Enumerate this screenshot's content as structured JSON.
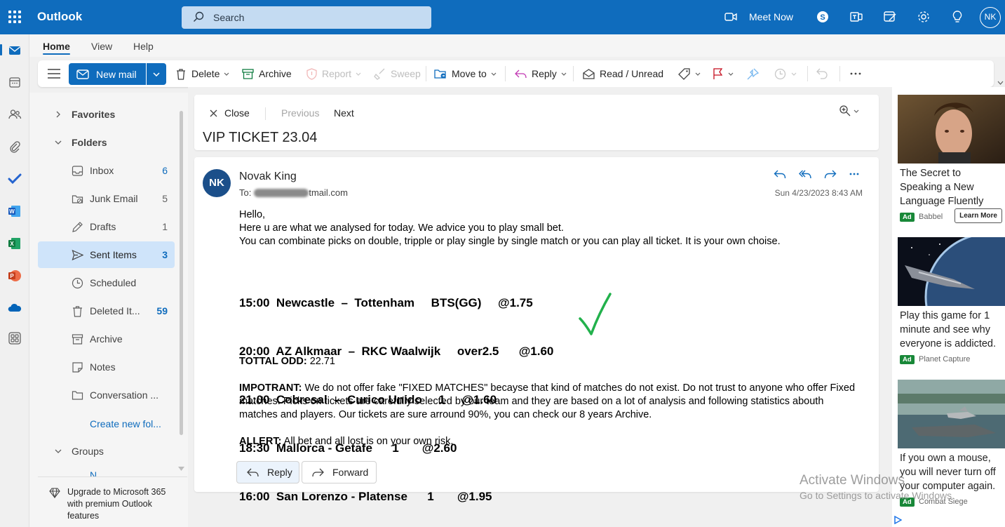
{
  "topbar": {
    "app_name": "Outlook",
    "search_placeholder": "Search",
    "meet_now": "Meet Now",
    "avatar_initials": "NK"
  },
  "tabs": [
    "Home",
    "View",
    "Help"
  ],
  "toolbar": {
    "new_mail": "New mail",
    "delete": "Delete",
    "archive": "Archive",
    "report": "Report",
    "sweep": "Sweep",
    "move_to": "Move to",
    "reply": "Reply",
    "read_unread": "Read / Unread"
  },
  "folders": {
    "favorites": "Favorites",
    "folders": "Folders",
    "items": [
      {
        "label": "Inbox",
        "count": "6"
      },
      {
        "label": "Junk Email",
        "count": "5"
      },
      {
        "label": "Drafts",
        "count": "1"
      },
      {
        "label": "Sent Items",
        "count": "3"
      },
      {
        "label": "Scheduled",
        "count": ""
      },
      {
        "label": "Deleted It...",
        "count": "59"
      },
      {
        "label": "Archive",
        "count": ""
      },
      {
        "label": "Notes",
        "count": ""
      },
      {
        "label": "Conversation ...",
        "count": ""
      }
    ],
    "create_new": "Create new fol...",
    "groups": "Groups",
    "groups_partial": "N",
    "upgrade": "Upgrade to Microsoft 365 with premium Outlook features"
  },
  "message_header": {
    "close": "Close",
    "previous": "Previous",
    "next": "Next",
    "subject": "VIP TICKET 23.04"
  },
  "message": {
    "sender_initials": "NK",
    "sender_name": "Novak King",
    "to_label": "To:",
    "to_visible": "tmail.com",
    "date": "Sun 4/23/2023 8:43 AM",
    "greeting": "Hello,",
    "line1": "Here u are what we analysed for today. We advice you to play small bet.",
    "line2": "You can combinate picks on double, tripple or play single by single match or you can play all ticket. It is your own choise.",
    "picks": [
      "15:00  Newcastle  –  Tottenham     BTS(GG)     @1.75",
      "20:00  AZ Alkmaar  –  RKC Waalwijk     over2.5      @1.60",
      "21:00  Cobresal  –  Curico Unido     1     @1.60",
      "18:30  Mallorca - Getafe      1       @2.60",
      "16:00  San Lorenzo - Platense      1       @1.95"
    ],
    "total_label": "TOTTAL ODD:",
    "total_value": "22.71",
    "important_label": "IMPOTRANT:",
    "important_text": "We do not offer fake \"FIXED MATCHES\" becayse that kind of matches do not exist. Do not trust to anyone who offer Fixed matches. Picks on tickets are carefully selected by our team and they are based on a lot of analysis and following statistics abouth matches and players. Our tickets are sure arround 90%, you can check our 8 years Archive.",
    "allert_label": "ALLERT:",
    "allert_text": "All bet and all lost is on your own risk.",
    "reply_button": "Reply",
    "forward_button": "Forward"
  },
  "ads": [
    {
      "title": "The Secret to Speaking a New Language Fluently",
      "badge": "Ad",
      "source": "Babbel",
      "cta": "Learn More"
    },
    {
      "title": "Play this game for 1 minute and see why everyone is addicted.",
      "badge": "Ad",
      "source": "Planet Capture",
      "cta": ""
    },
    {
      "title": "If you own a mouse, you will never turn off your computer again.",
      "badge": "Ad",
      "source": "Combat Siege",
      "cta": ""
    }
  ],
  "watermark": {
    "line1": "Activate Windows",
    "line2": "Go to Settings to activate Windows."
  },
  "colors": {
    "brand": "#0f6cbd",
    "selected": "#cfe4fa",
    "avatar": "#1b4f8a",
    "check": "#22b14c",
    "ad_badge": "#188838"
  }
}
